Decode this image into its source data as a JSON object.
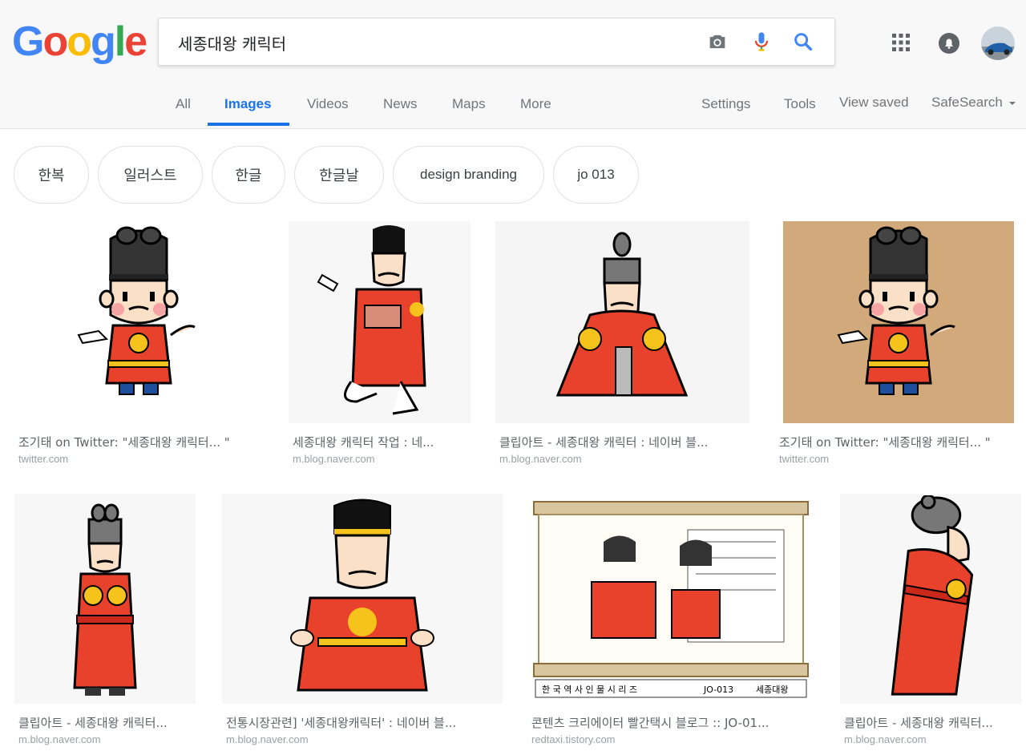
{
  "logo": {
    "letters": [
      "G",
      "o",
      "o",
      "g",
      "l",
      "e"
    ],
    "colors": [
      "#4285F4",
      "#EA4335",
      "#FBBC05",
      "#4285F4",
      "#34A853",
      "#EA4335"
    ]
  },
  "search": {
    "query": "세종대왕 캐릭터"
  },
  "icons": {
    "camera": "camera-icon",
    "mic": "microphone-icon",
    "search": "search-icon",
    "apps": "apps-grid-icon",
    "notifications": "notifications-icon",
    "avatar": "avatar"
  },
  "colors": {
    "accent": "#1a73e8",
    "chip_border": "#dfe1e5"
  },
  "tabs": {
    "all": "All",
    "images": "Images",
    "videos": "Videos",
    "news": "News",
    "maps": "Maps",
    "more": "More",
    "settings": "Settings",
    "tools": "Tools",
    "view_saved": "View saved",
    "safesearch": "SafeSearch"
  },
  "chips": [
    "한복",
    "일러스트",
    "한글",
    "한글날",
    "design branding",
    "jo 013"
  ],
  "results": [
    {
      "caption": "조기태 on Twitter: \"세종대왕 캐릭터... \"",
      "domain": "twitter.com"
    },
    {
      "caption": "세종대왕 캐릭터 작업 : 네...",
      "domain": "m.blog.naver.com"
    },
    {
      "caption": "클립아트 - 세종대왕 캐릭터 : 네이버 블...",
      "domain": "m.blog.naver.com"
    },
    {
      "caption": "조기태 on Twitter: \"세종대왕 캐릭터... \"",
      "domain": "twitter.com"
    },
    {
      "caption": "클립아트 - 세종대왕 캐릭터...",
      "domain": "m.blog.naver.com"
    },
    {
      "caption": "전통시장관련] '세종대왕캐릭터' : 네이버 블...",
      "domain": "m.blog.naver.com"
    },
    {
      "caption": "콘텐츠 크리에이터 빨간택시 블로그 :: JO-01...",
      "domain": "redtaxi.tistory.com"
    },
    {
      "caption": "클립아트 - 세종대왕 캐릭터...",
      "domain": "m.blog.naver.com"
    }
  ],
  "scroll_text": {
    "left": "한 국 역 사 인 물 시 리 즈",
    "code": "JO-013",
    "name": "세종대왕"
  }
}
